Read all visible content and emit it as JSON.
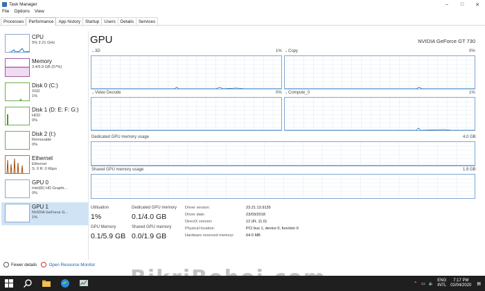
{
  "window": {
    "title": "Task Manager",
    "min": "–",
    "max": "□",
    "close": "✕"
  },
  "menu": [
    "File",
    "Options",
    "View"
  ],
  "tabs": [
    "Processes",
    "Performance",
    "App history",
    "Startup",
    "Users",
    "Details",
    "Services"
  ],
  "sidebar": [
    {
      "name": "CPU",
      "line2": "5% 2.21 GHz",
      "line3": "",
      "color": "#1175b8"
    },
    {
      "name": "Memory",
      "line2": "3.4/5.9 GB (57%)",
      "line3": "",
      "color": "#8b1f8b"
    },
    {
      "name": "Disk 0 (C:)",
      "line2": "SSD",
      "line3": "1%",
      "color": "#4c9a2a"
    },
    {
      "name": "Disk 1 (D: E: F: G:)",
      "line2": "HDD",
      "line3": "0%",
      "color": "#4c9a2a"
    },
    {
      "name": "Disk 2 (I:)",
      "line2": "Removable",
      "line3": "0%",
      "color": "#4c9a2a"
    },
    {
      "name": "Ethernet",
      "line2": "Ethernet",
      "line3": "S: 0 R: 0 Kbps",
      "color": "#a04c0c"
    },
    {
      "name": "GPU 0",
      "line2": "Intel(R) HD Graphi...",
      "line3": "0%",
      "color": "#1175b8"
    },
    {
      "name": "GPU 1",
      "line2": "NVIDIA GeForce G...",
      "line3": "1%",
      "color": "#1175b8"
    }
  ],
  "main": {
    "title": "GPU",
    "model": "NVIDIA GeForce GT 730",
    "graphs": {
      "g3d": {
        "label": "3D",
        "pct": "1%"
      },
      "copy": {
        "label": "Copy",
        "pct": "0%"
      },
      "video": {
        "label": "Video Decode",
        "pct": "0%"
      },
      "compute": {
        "label": "Compute_0",
        "pct": "1%"
      },
      "dedicated": {
        "label": "Dedicated GPU memory usage",
        "max": "4.0 GB"
      },
      "shared": {
        "label": "Shared GPU memory usage",
        "max": "1.9 GB"
      }
    },
    "stats": {
      "utilisation_label": "Utilisation",
      "utilisation": "1%",
      "dedicated_label": "Dedicated GPU memory",
      "dedicated": "0.1/4.0 GB",
      "gpu_mem_label": "GPU Memory",
      "gpu_mem": "0.1/5.9 GB",
      "shared_label": "Shared GPU memory",
      "shared": "0.0/1.9 GB"
    },
    "info": [
      {
        "k": "Driver version:",
        "v": "23.21.13.9135"
      },
      {
        "k": "Driver date:",
        "v": "23/03/2018"
      },
      {
        "k": "DirectX version:",
        "v": "12 (FL 11.0)"
      },
      {
        "k": "Physical location:",
        "v": "PCI bus 1, device 0, function 0"
      },
      {
        "k": "Hardware reserved memory:",
        "v": "64.0 MB"
      }
    ]
  },
  "footer": {
    "fewer": "Fewer details",
    "resmon": "Open Resource Monitor"
  },
  "taskbar": {
    "lang1": "ENG",
    "lang2": "INTL",
    "time": "7:17 PM",
    "date": "02/04/2020"
  },
  "watermark": "BikriBohoj.com"
}
